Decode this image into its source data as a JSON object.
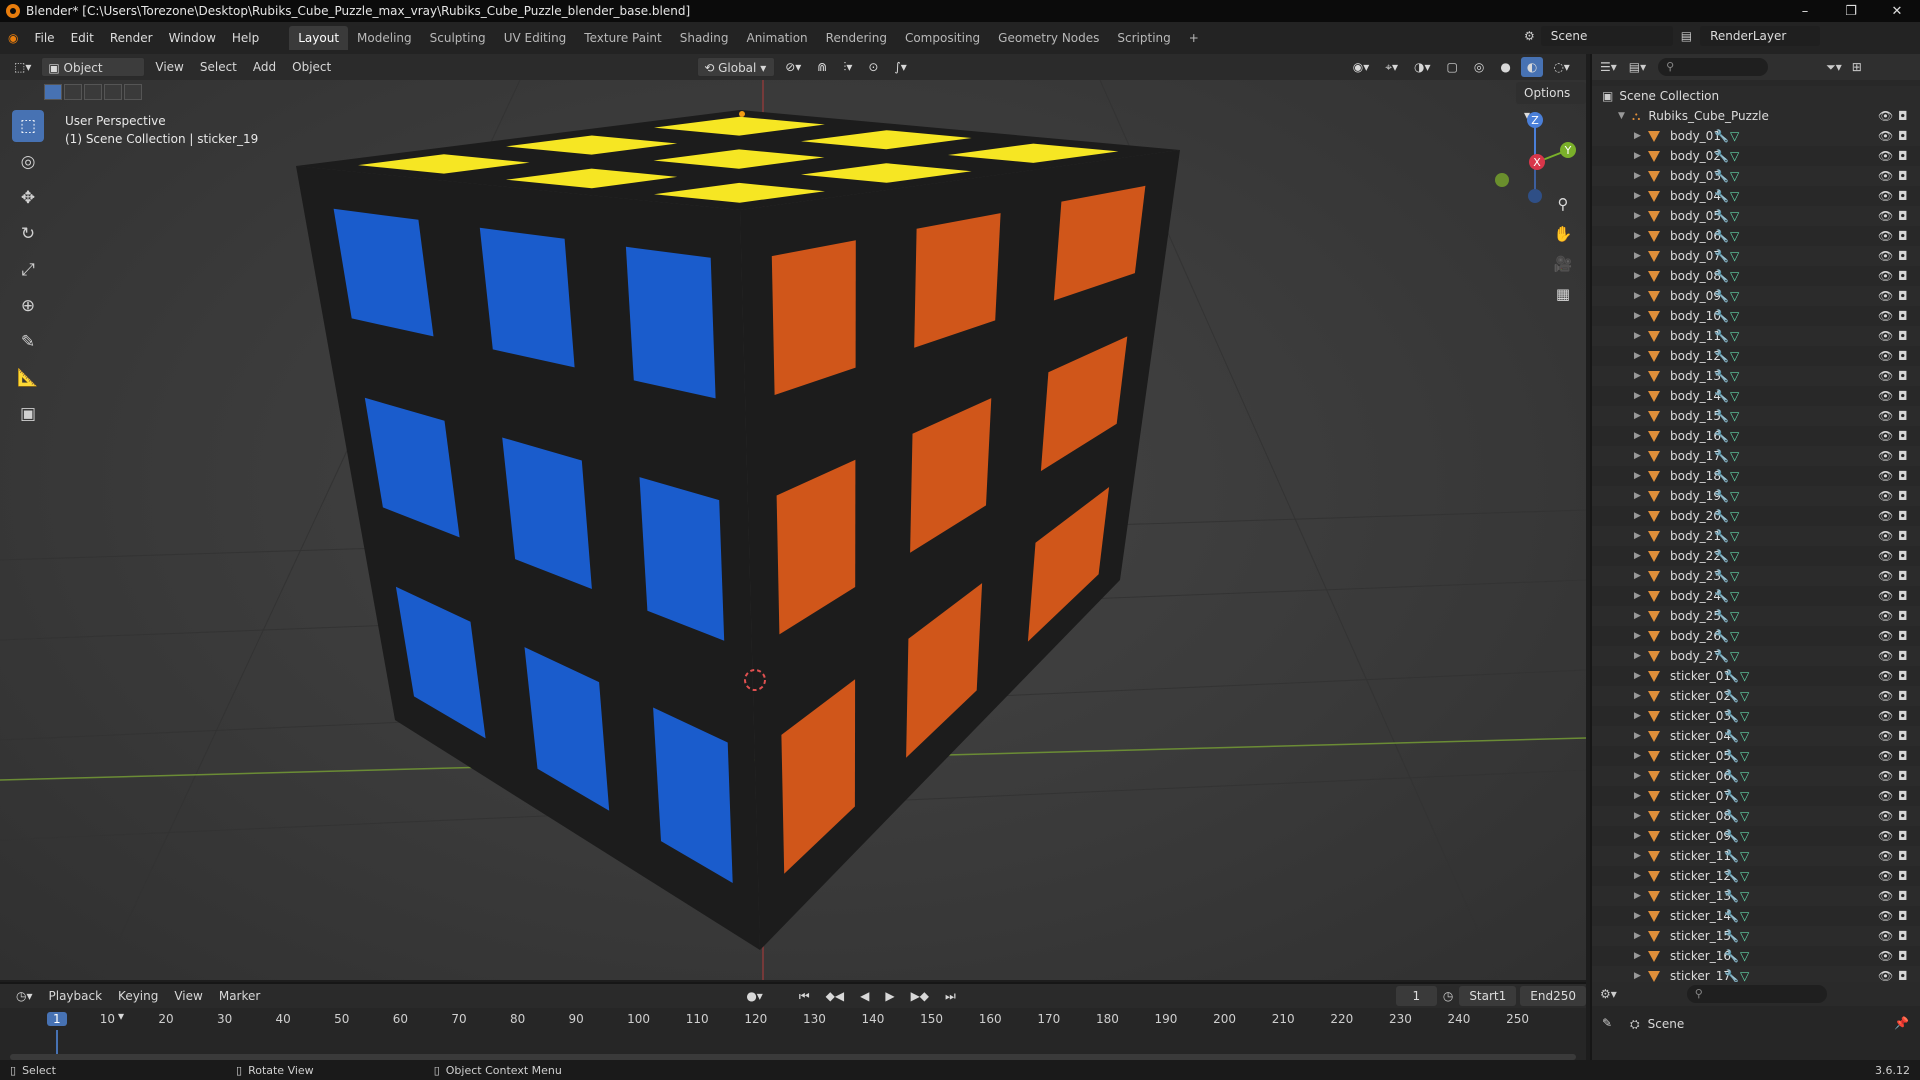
{
  "window": {
    "title": "Blender* [C:\\Users\\Torezone\\Desktop\\Rubiks_Cube_Puzzle_max_vray\\Rubiks_Cube_Puzzle_blender_base.blend]"
  },
  "menu": [
    "File",
    "Edit",
    "Render",
    "Window",
    "Help"
  ],
  "workspaces": [
    "Layout",
    "Modeling",
    "Sculpting",
    "UV Editing",
    "Texture Paint",
    "Shading",
    "Animation",
    "Rendering",
    "Compositing",
    "Geometry Nodes",
    "Scripting"
  ],
  "top_right": {
    "scene": "Scene",
    "render_layer": "RenderLayer"
  },
  "viewport_header": {
    "mode": "Object Mode",
    "menus": [
      "View",
      "Select",
      "Add",
      "Object"
    ],
    "orientation": "Global",
    "options_label": "Options"
  },
  "viewport": {
    "perspective": "User Perspective",
    "collection_info": "(1) Scene Collection | sticker_19"
  },
  "gizmo": {
    "x": "X",
    "y": "Y",
    "z": "Z"
  },
  "cube": {
    "colors": {
      "top": "#f6e623",
      "left": "#1a5ccc",
      "right": "#d0561a",
      "body": "#1c1c1c"
    }
  },
  "outliner": {
    "root": "Scene Collection",
    "collection": "Rubiks_Cube_Puzzle",
    "items": [
      "body_01",
      "body_02",
      "body_03",
      "body_04",
      "body_05",
      "body_06",
      "body_07",
      "body_08",
      "body_09",
      "body_10",
      "body_11",
      "body_12",
      "body_13",
      "body_14",
      "body_15",
      "body_16",
      "body_17",
      "body_18",
      "body_19",
      "body_20",
      "body_21",
      "body_22",
      "body_23",
      "body_24",
      "body_25",
      "body_26",
      "body_27",
      "sticker_01",
      "sticker_02",
      "sticker_03",
      "sticker_04",
      "sticker_05",
      "sticker_06",
      "sticker_07",
      "sticker_08",
      "sticker_09",
      "sticker_11",
      "sticker_12",
      "sticker_13",
      "sticker_14",
      "sticker_15",
      "sticker_16",
      "sticker_17"
    ]
  },
  "timeline": {
    "menus": [
      "Playback",
      "Keying",
      "View",
      "Marker"
    ],
    "current_frame": "1",
    "start_label": "Start",
    "start": "1",
    "end_label": "End",
    "end": "250",
    "ticks": [
      "1",
      "10",
      "20",
      "30",
      "40",
      "50",
      "60",
      "70",
      "80",
      "90",
      "100",
      "110",
      "120",
      "130",
      "140",
      "150",
      "160",
      "170",
      "180",
      "190",
      "200",
      "210",
      "220",
      "230",
      "240",
      "250"
    ]
  },
  "properties": {
    "scene_label": "Scene"
  },
  "statusbar": {
    "select": "Select",
    "rotate": "Rotate View",
    "context": "Object Context Menu",
    "version": "3.6.12"
  }
}
